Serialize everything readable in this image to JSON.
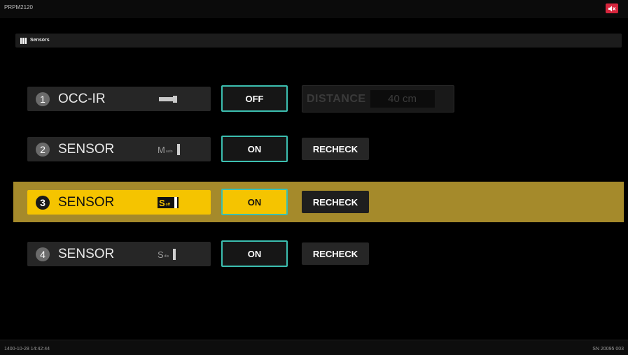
{
  "window": {
    "title": "PRPM2120"
  },
  "section": {
    "label": "Sensors"
  },
  "rows": [
    {
      "num": "1",
      "name": "OCC-IR",
      "toggle": "OFF",
      "distance_label": "DISTANCE",
      "distance_value": "40 cm"
    },
    {
      "num": "2",
      "name": "SENSOR",
      "mode": "M",
      "mode_sub": "auto",
      "toggle": "ON",
      "recheck": "RECHECK"
    },
    {
      "num": "3",
      "name": "SENSOR",
      "mode": "S",
      "mode_sub": "off",
      "toggle": "ON",
      "recheck": "RECHECK",
      "selected": true
    },
    {
      "num": "4",
      "name": "SENSOR",
      "mode": "S",
      "mode_sub": "dis",
      "toggle": "ON",
      "recheck": "RECHECK"
    }
  ],
  "footer": {
    "datetime": "1400-10-28 14:42:44",
    "serial": "SN 20095 003"
  },
  "colors": {
    "accent_yellow": "#f5c400",
    "highlight_band": "#a58a2b",
    "toggle_border": "#3cbfb0",
    "mute_red": "#d7263d"
  },
  "icons": {
    "mute": "speaker-mute-icon",
    "section": "grid-icon",
    "sensor1": "plug-icon"
  }
}
